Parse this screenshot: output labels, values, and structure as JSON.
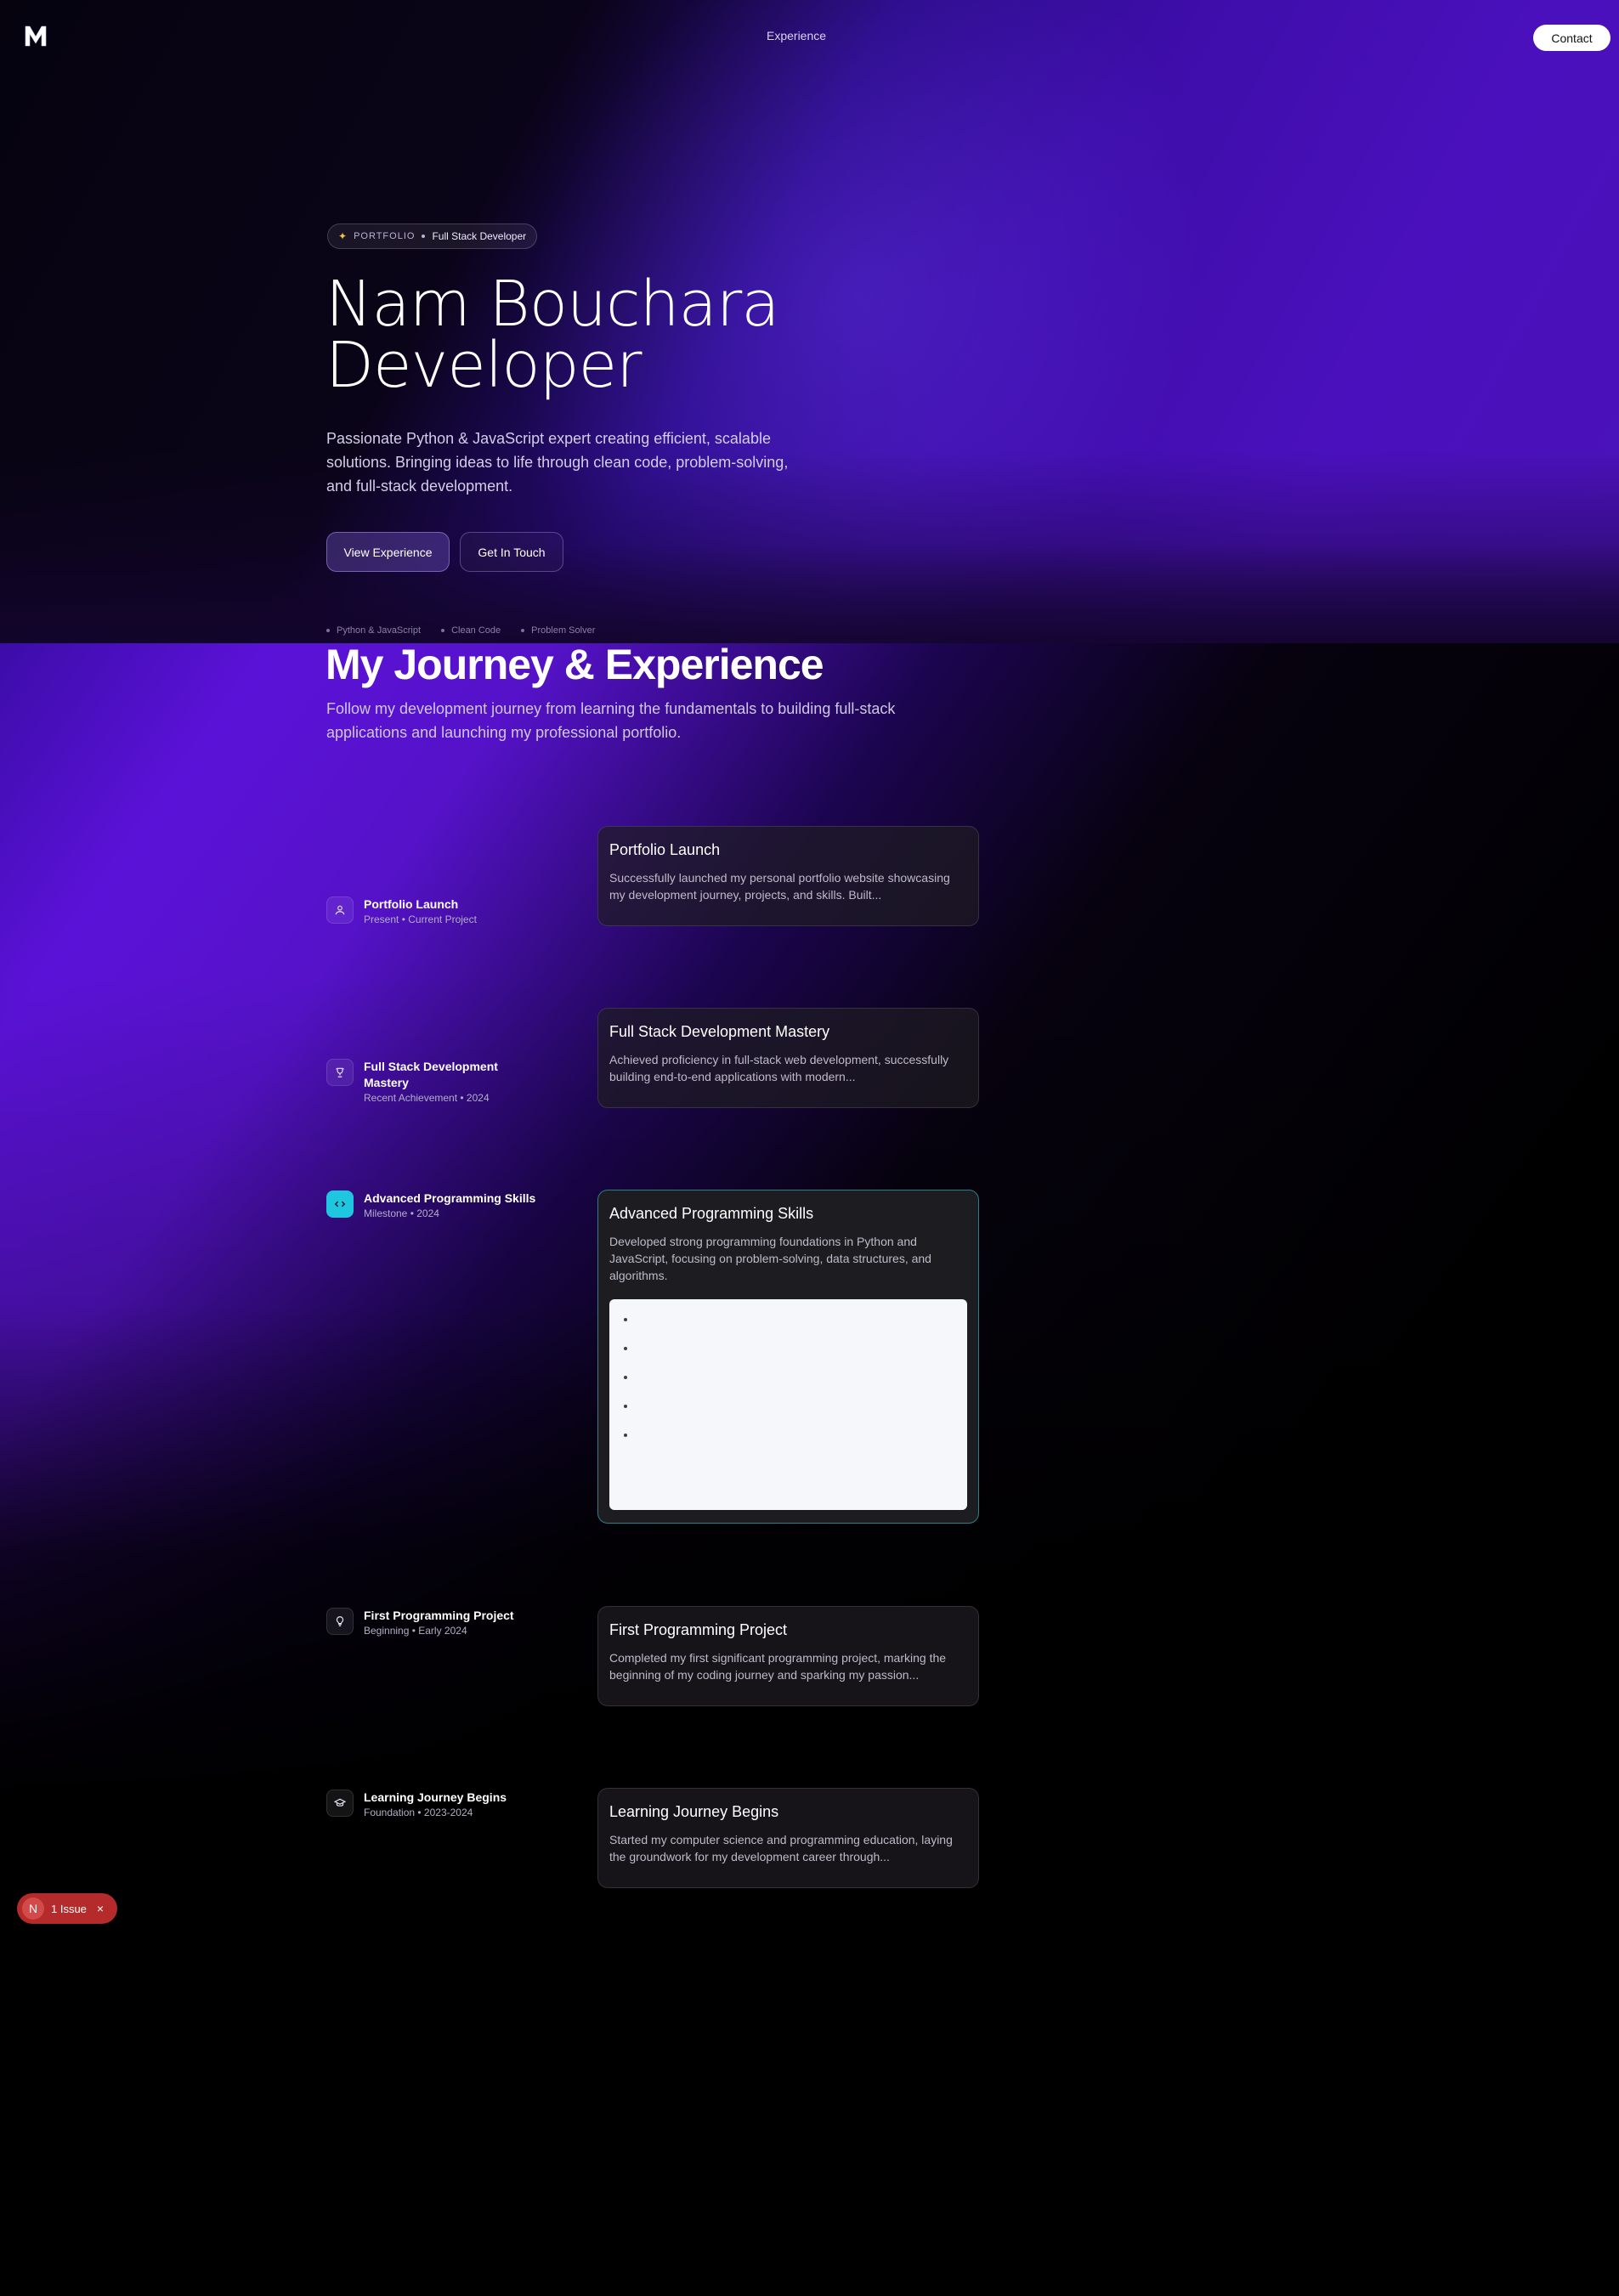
{
  "nav": {
    "logo": "M",
    "link": "Experience",
    "contact": "Contact"
  },
  "hero": {
    "badge_tag": "PORTFOLIO",
    "badge_role": "Full Stack Developer",
    "title_line1": "Nam Bouchara",
    "title_line2": "Developer",
    "description": "Passionate Python & JavaScript expert creating efficient, scalable solutions. Bringing ideas to life through clean code, problem-solving, and full-stack development.",
    "primary_button": "View Experience",
    "secondary_button": "Get In Touch",
    "chips": [
      "Python & JavaScript",
      "Clean Code",
      "Problem Solver"
    ]
  },
  "journey": {
    "title": "My Journey & Experience",
    "subtitle": "Follow my development journey from learning the fundamentals to building full-stack applications and launching my professional portfolio.",
    "items": [
      {
        "name": "Portfolio Launch",
        "meta": "Present • Current Project",
        "icon": "user-icon",
        "card_title": "Portfolio Launch",
        "card_desc": "Successfully launched my personal portfolio website showcasing my development journey, projects, and skills. Built..."
      },
      {
        "name": "Full Stack Development Mastery",
        "meta": "Recent Achievement • 2024",
        "icon": "trophy-icon",
        "card_title": "Full Stack Development Mastery",
        "card_desc": "Achieved proficiency in full-stack web development, successfully building end-to-end applications with modern..."
      },
      {
        "name": "Advanced Programming Skills",
        "meta": "Milestone • 2024",
        "icon": "code-icon",
        "card_title": "Advanced Programming Skills",
        "card_desc": "Developed strong programming foundations in Python and JavaScript, focusing on problem-solving, data structures, and algorithms."
      },
      {
        "name": "First Programming Project",
        "meta": "Beginning • Early 2024",
        "icon": "lightbulb-icon",
        "card_title": "First Programming Project",
        "card_desc": "Completed my first significant programming project, marking the beginning of my coding journey and sparking my passion..."
      },
      {
        "name": "Learning Journey Begins",
        "meta": "Foundation • 2023-2024",
        "icon": "graduation-cap-icon",
        "card_title": "Learning Journey Begins",
        "card_desc": "Started my computer science and programming education, laying the groundwork for my development career through..."
      }
    ]
  },
  "dev_overlay": {
    "badge_letter": "N",
    "issues": "1 Issue",
    "close": "×"
  },
  "colors": {
    "accent_cyan": "#1fc6e0",
    "hero_purple": "#4a10bd",
    "issue_red": "#b52a2a"
  }
}
